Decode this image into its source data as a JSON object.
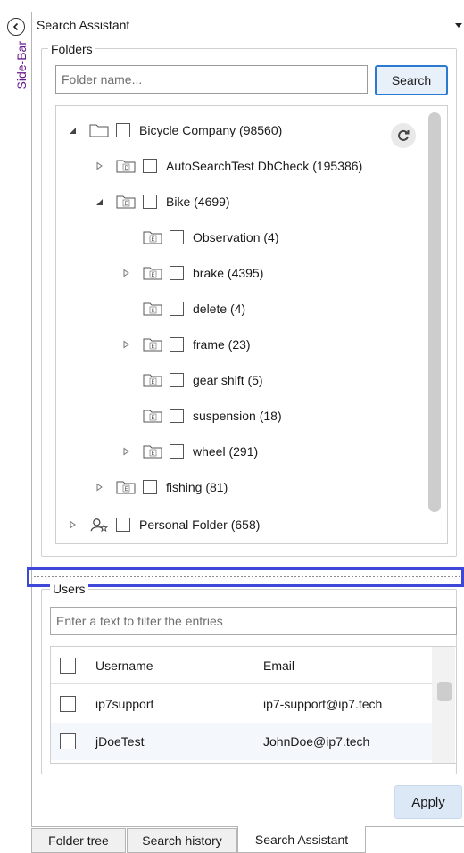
{
  "sidebar": {
    "label": "Side-Bar"
  },
  "panel": {
    "title": "Search Assistant"
  },
  "folders": {
    "legend": "Folders",
    "input_placeholder": "Folder name...",
    "search_label": "Search",
    "tree": [
      {
        "label": "Bicycle Company (98560)",
        "expanded": true,
        "letter": ""
      },
      {
        "label": "AutoSearchTest DbCheck (195386)",
        "expanded": false,
        "letter": "D"
      },
      {
        "label": "Bike (4699)",
        "expanded": true,
        "letter": "E"
      },
      {
        "label": "Observation (4)",
        "letter": "E"
      },
      {
        "label": "brake (4395)",
        "expanded": false,
        "letter": "E"
      },
      {
        "label": "delete (4)",
        "letter": "S"
      },
      {
        "label": "frame (23)",
        "expanded": false,
        "letter": "E"
      },
      {
        "label": "gear shift (5)",
        "letter": "E"
      },
      {
        "label": "suspension (18)",
        "letter": "E"
      },
      {
        "label": "wheel (291)",
        "expanded": false,
        "letter": "E"
      },
      {
        "label": "fishing (81)",
        "expanded": false,
        "letter": "E"
      },
      {
        "label": "Personal Folder (658)",
        "expanded": false
      }
    ]
  },
  "users": {
    "legend": "Users",
    "filter_placeholder": "Enter a text to filter the entries",
    "columns": {
      "username": "Username",
      "email": "Email"
    },
    "rows": [
      {
        "username": "ip7support",
        "email": "ip7-support@ip7.tech"
      },
      {
        "username": "jDoeTest",
        "email": "JohnDoe@ip7.tech"
      }
    ]
  },
  "apply_label": "Apply",
  "tabs": [
    "Folder tree",
    "Search history",
    "Search Assistant"
  ],
  "colors": {
    "accent": "#2a7ad2",
    "splitter": "#3d47d8",
    "sidebar_text": "#6a1a8f"
  }
}
